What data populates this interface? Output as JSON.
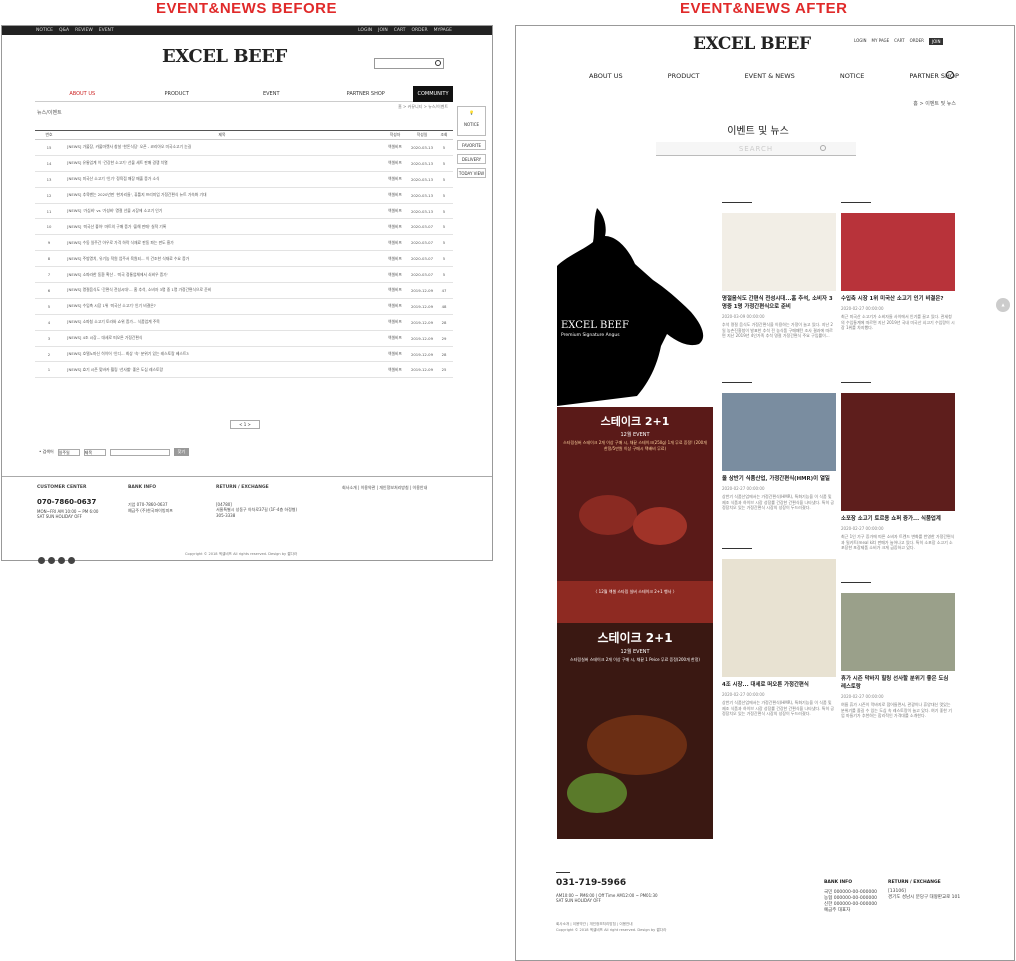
{
  "headings": {
    "before": "EVENT&NEWS BEFORE",
    "after": "EVENT&NEWS AFTER"
  },
  "brand": "EXCEL BEEF",
  "before": {
    "topbar_left": [
      "NOTICE",
      "Q&A",
      "REVIEW",
      "EVENT"
    ],
    "topbar_right": [
      "LOGIN",
      "JOIN",
      "CART",
      "ORDER",
      "MYPAGE"
    ],
    "nav": [
      "ABOUT US",
      "PRODUCT",
      "EVENT",
      "PARTNER SHOP",
      "COMMUNITY"
    ],
    "crumb": "뉴스/이벤트",
    "crumb_right": "홈 > 커뮤니티 > 뉴스/이벤트",
    "table_headers": [
      "번호",
      "제목",
      "작성자",
      "작성일",
      "조회"
    ],
    "rows": [
      [
        "15",
        "[NEWS] 가물장, 카물마켓사 창설 '한돈식당' 오픈 - 코리아오 미국소고기 눈길",
        "엑셀비프",
        "2020-03-13",
        "5"
      ],
      [
        "14",
        "[NEWS] 유통업계 이 '건강한 소고기' 선물 세트 판매 경쟁 치열",
        "엑셀비프",
        "2020-03-13",
        "5"
      ],
      [
        "13",
        "[NEWS] 미국산 소고기 '인기' 정육점 매장 매출 증가 소식",
        "엑셀비프",
        "2020-03-13",
        "5"
      ],
      [
        "12",
        "[NEWS] 추육밴는 2020년판 '한자리들', 퓨틀지 프리미엄 가정간편식 뉴트 가속화 기대",
        "엑셀비프",
        "2020-03-13",
        "5"
      ],
      [
        "11",
        "[NEWS] '가심비' vs '가성비' 명절 선물 시장에 소고기 인기",
        "엑셀비프",
        "2020-03-13",
        "5"
      ],
      [
        "10",
        "[NEWS] '미국산 좋아' 마트의 구매 증가 '올해 판매' 실적 기록 ",
        "엑셀비프",
        "2020-03-07",
        "5"
      ],
      [
        "9",
        "[NEWS] 수동 일주간 아우로 가격 하락 식재료 판동 파는 판도 흥가",
        "엑셀비프",
        "2020-03-07",
        "5"
      ],
      [
        "8",
        "[NEWS] 주방명치, 유기농 적원 업주서 육원되... 이 건조한 식재료 수요 증가",
        "엑셀비프",
        "2020-03-07",
        "5"
      ],
      [
        "7",
        "[NEWS] 소파라한 동환 확산 - '미국 정통업체에서 쇠비우 증가'",
        "엑셀비프",
        "2020-03-07",
        "5"
      ],
      [
        "6",
        "[NEWS] 명절음식도 '간편식 전성시대'... 홈 추석, 소비자 3명 중 1명 가정간편식으로 준비",
        "엑셀비프",
        "2019-12-09",
        "47"
      ],
      [
        "5",
        "[NEWS] 수입축 시장 1위 '미국산 소고기' 인기 비결은?",
        "엑셀비프",
        "2019-12-09",
        "48"
      ],
      [
        "4",
        "[NEWS] 소파칭 소고기 토라와 쇼위 증가... 식품업계 주목",
        "엑셀비프",
        "2019-12-09",
        "28"
      ],
      [
        "3",
        "[NEWS] 4조 시장... 대세로 떠오른 가정간편식",
        "엑셀비프",
        "2019-12-09",
        "29"
      ],
      [
        "2",
        "[NEWS] 호텔노마신 히이어 '인디... 최상 '숙' 분위기 있는 레스토랑 베스트3",
        "엑셀비프",
        "2019-12-09",
        "28"
      ],
      [
        "1",
        "[NEWS] 효기 시즌 맞바카 휠링 '선사할' 좋은 도심 레스토랑",
        "엑셀비프",
        "2019-12-09",
        "25"
      ]
    ],
    "side": [
      "NOTICE",
      "FAVORITE",
      "DELIVERY",
      "TODAY VIEW"
    ],
    "pager": "< 1 >",
    "search_label": "• 검색어",
    "search_opt1": "일주일",
    "search_opt2": "제목",
    "search_btn": "찾기",
    "footer": {
      "c1_title": "CUSTOMER CENTER",
      "phone": "070-7860-0637",
      "hours": "MON~FRI AM 10:00 ~ PM 6:00",
      "hours2": "SAT SUN HOLIDAY OFF",
      "c2_title": "BANK INFO",
      "bank1": "기업 070-7860-0637",
      "bank2": "예금주 (주)한국파이빙피프",
      "c3_title": "RETURN / EXCHANGE",
      "return1": "[04780]",
      "return2": "서울특별시 성동구 아차로37길 (1F-4층 하정형)",
      "return3": "305-3338",
      "links": "회사소개 | 이용약관 | 개인정보처리방침 | 이용안내",
      "copy": "Copyright © 2018 엑셀비프 All rights reserved. Design by 짧다라"
    }
  },
  "after": {
    "util": [
      "LOGIN",
      "MY PAGE",
      "CART",
      "ORDER",
      "JOIN"
    ],
    "nav": [
      "ABOUT US",
      "PRODUCT",
      "EVENT & NEWS",
      "NOTICE",
      "PARTNER SHOP"
    ],
    "crumb": "홈 > 이벤트 및 뉴스",
    "title": "이벤트 및 뉴스",
    "search_placeholder": "SEARCH",
    "cow_label": "EXCEL BEEF",
    "cow_sub": "Premium Signature Angus",
    "banner1": {
      "title": "스테이크 2+1",
      "sub": "12월 EVENT",
      "text": "스타링실버 스테이크 2개 이상 구매 시, 채끝 스테이크(250g) 1개 무료 증정! (200개 한정/5만원 이상 구매시 택배비 무료)",
      "foot": "〈 12월 엑셀 스타링 실버 스테이크 2+1 행사 〉"
    },
    "banner2": {
      "title": "스테이크 2+1",
      "sub": "12월 EVENT",
      "text": "스타링실버 스테이크 2개 이상 구매 시, 채끝 1 Peice 무료 증정(200개 한정)"
    },
    "cards": [
      {
        "title": "명절음식도 간편식 전성시대...홈 추석, 소비자 3명중 1명 가정간편식으로 준비",
        "date": "2020-03-09 00:00:00",
        "body": "추석 명절 음식도 가정간편식을 이용하는 가정이 늘고 있다. 지난 2일 농촌진흥청이 발표한 추석 전 농식품 구매패턴 조사 결과에 따르면 지난 2019년 4인가족 추석 명절 가정간편식 주요 구입률이..."
      },
      {
        "title": "수입축 시장 1위 미국산 소고기 인기 비결은?",
        "date": "2020-02-27 00:00:00",
        "body": "최근 미국산 소고기가 소비자들 사이에서 인기를 끌고 있다. 관세청의 수입통계에 따르면 지난 2019년 국내 미국산 쇠고기 수입량이 시장 1위를 차지했다."
      },
      {
        "title": "올 상반기 식품산업, 가정간편식(HMR)이 열일",
        "date": "2020-02-27 00:00:00",
        "body": "상반기 식품산업에서는 가정간편식(HMR), 특화기능을 이 식품 및 제조 식품과 하이브 시장 성장률 건강한 간편식을 나타냈다. 특히 공정장치오 있는 가정간편식 시장의 성장이 두드러졌다."
      },
      {
        "title": "소포장 소고기 토르용 쇼퍼 증가... 식품업계",
        "date": "2020-02-27 00:00:00",
        "body": "최근 1인 가구 증가에 따른 소비자 트렌드 변화를 반영한 가정간편식과 밀키트(meal kit) 판매가 늘어나고 있다. 특히 소포장 소고기 소포장한 포장제품 소비가 크게 급증하고 있다."
      },
      {
        "title": "4조 시장... 대세로 떠오른 가정간편식",
        "date": "2020-02-27 00:00:00",
        "body": "상반기 식품산업에서는 가정간편식(HMR), 특화기능을 이 식품 및 제조 식품과 하이브 시장 성장률 건강한 간편식을 나타냈다. 특히 공정장치오 있는 가정간편식 시장의 성장이 두드러졌다."
      },
      {
        "title": "휴가 시즌 막바지 힐링 선사할 분위기 좋은 도심 레스토랑",
        "date": "2020-02-27 00:00:00",
        "body": "여름 휴가 시즌이 막바지로 접어들면서, 관광이나 휴양대신 멋있는 분위기를 즐길 수 있는 도심 속 레스토랑이 늘고 있다. 여기 좋한 기업 마들기가 추천하는 합리적인 가격대를 소개한다."
      }
    ],
    "footer": {
      "phone": "031-719-5966",
      "hours": "AM10:00 ~ PM6:00 | Off Time AM12:00 ~ PM01:30",
      "hours2": "SAT SUN HOLIDAY OFF",
      "bank_title": "BANK INFO",
      "bank1": "국민 000000-00-000000",
      "bank2": "농협 000000-00-000000",
      "bank3": "신한 000000-00-000000",
      "bank4": "예금주 대표자",
      "return_title": "RETURN / EXCHANGE",
      "return1": "[13106]",
      "return2": "경기도 성남시 분당구 대왕판교로 101",
      "links": "회사소개 | 이용약관 | 개인정보처리방침 | 이용안내",
      "copy": "Copyright © 2018 엑셀비프 All right reserved. Design by 짧다라"
    }
  }
}
